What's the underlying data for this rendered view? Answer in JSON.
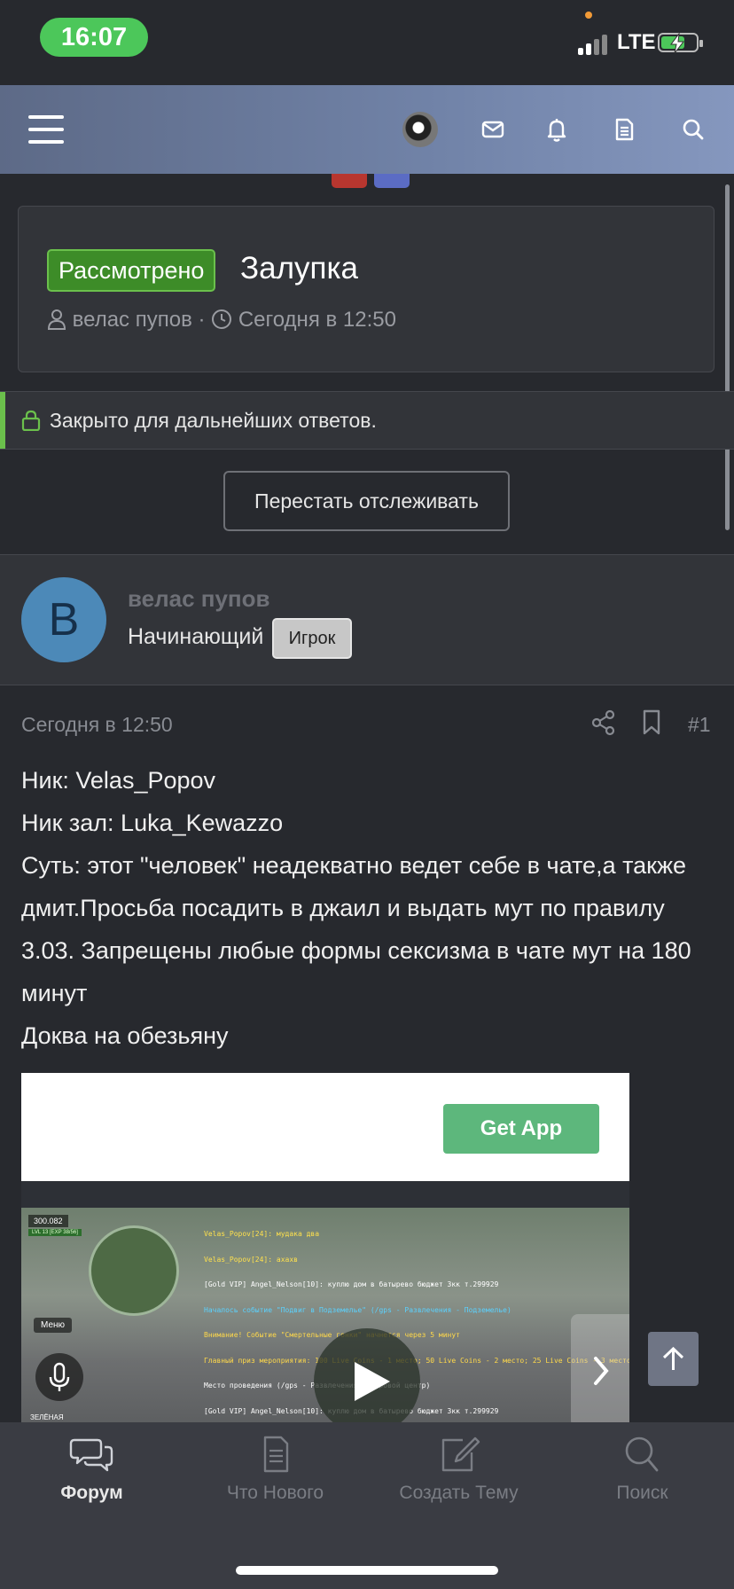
{
  "status_bar": {
    "time": "16:07",
    "network": "LTE"
  },
  "thread": {
    "prefix": "Рассмотрено",
    "title": "Залупка",
    "author": "велас пупов",
    "separator": "·",
    "date": "Сегодня в 12:50"
  },
  "notice": {
    "closed_text": "Закрыто для дальнейших ответов."
  },
  "actions": {
    "unwatch_label": "Перестать отслеживать"
  },
  "post": {
    "avatar_letter": "В",
    "username": "велас пупов",
    "user_title": "Начинающий",
    "user_badge": "Игрок",
    "date": "Сегодня в 12:50",
    "number": "#1",
    "lines": [
      "Ник: Velas_Popov",
      "Ник зал: Luka_Kewazzo",
      "Суть: этот \"человек\" неадекватно ведет себе в чате,а также дмит.Просьба посадить в джаил и выдать мут по правилу 3.03. Запрещены любые формы сексизма в чате мут на 180 минут",
      "Доква на обезьяну"
    ]
  },
  "embed": {
    "get_app_label": "Get App",
    "hud_money": "300.082",
    "hud_level": "LVL 13 [EXP 38/56]",
    "menu_label": "Меню",
    "zone_label": "ЗЕЛЁНАЯ",
    "chat_lines": [
      "Velas_Popov[24]: мудака два",
      "Velas_Popov[24]: ахахв",
      "[Gold VIP] Angel_Nelson[10]: куплю дом в батырево бюджет 3кк т.299929",
      "Началось событие \"Подвиг в Подземелье\" (/gps - Развлечения - Подземелье)",
      "Внимание! Событие \"Смертельные гонки\" начнется через 5 минут",
      "Главный приз мероприятия: 100 Live Coins - 1 место; 50 Live Coins - 2 место; 25 Live Coins - 3 место.",
      "Место проведения (/gps - Развлечения - Игровой центр)",
      "[Gold VIP] Angel_Nelson[10]: куплю дом в батырево бюджет 3кк т.299929"
    ]
  },
  "tabbar": {
    "items": [
      {
        "label": "Форум",
        "icon": "forum-chat-icon",
        "active": true
      },
      {
        "label": "Что Нового",
        "icon": "document-icon",
        "active": false
      },
      {
        "label": "Создать Тему",
        "icon": "edit-icon",
        "active": false
      },
      {
        "label": "Поиск",
        "icon": "search-icon",
        "active": false
      }
    ]
  },
  "colors": {
    "background": "#27292e",
    "header_gradient_start": "#5d6a87",
    "header_gradient_end": "#8597be",
    "prefix_green": "#3d8c28",
    "get_app_green": "#5db77c",
    "time_pill_green": "#4cc75a"
  }
}
